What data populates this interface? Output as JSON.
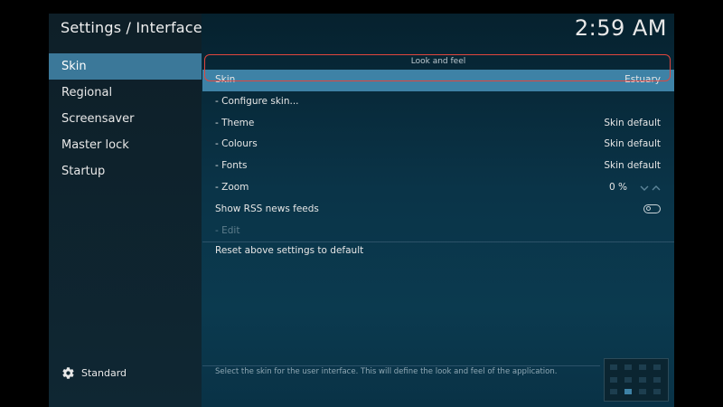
{
  "header": {
    "title": "Settings / Interface",
    "clock": "2:59 AM"
  },
  "sidebar": {
    "items": [
      {
        "label": "Skin",
        "active": true
      },
      {
        "label": "Regional"
      },
      {
        "label": "Screensaver"
      },
      {
        "label": "Master lock"
      },
      {
        "label": "Startup"
      }
    ],
    "settings_level": "Standard"
  },
  "section": {
    "label": "Look and feel"
  },
  "settings": [
    {
      "label": "Skin",
      "value": "Estuary"
    },
    {
      "label": "- Configure skin..."
    },
    {
      "label": "- Theme",
      "value": "Skin default"
    },
    {
      "label": "- Colours",
      "value": "Skin default"
    },
    {
      "label": "- Fonts",
      "value": "Skin default"
    },
    {
      "label": "- Zoom",
      "value": "0 %"
    },
    {
      "label": "Show RSS news feeds",
      "enabled": false
    },
    {
      "label": "- Edit"
    }
  ],
  "reset_label": "Reset above settings to default",
  "help_text": "Select the skin for the user interface. This will define the look and feel of the application.",
  "colors": {
    "accent": "#3e82a6",
    "focus_ring": "#e0463e",
    "background": "#0a3448"
  }
}
